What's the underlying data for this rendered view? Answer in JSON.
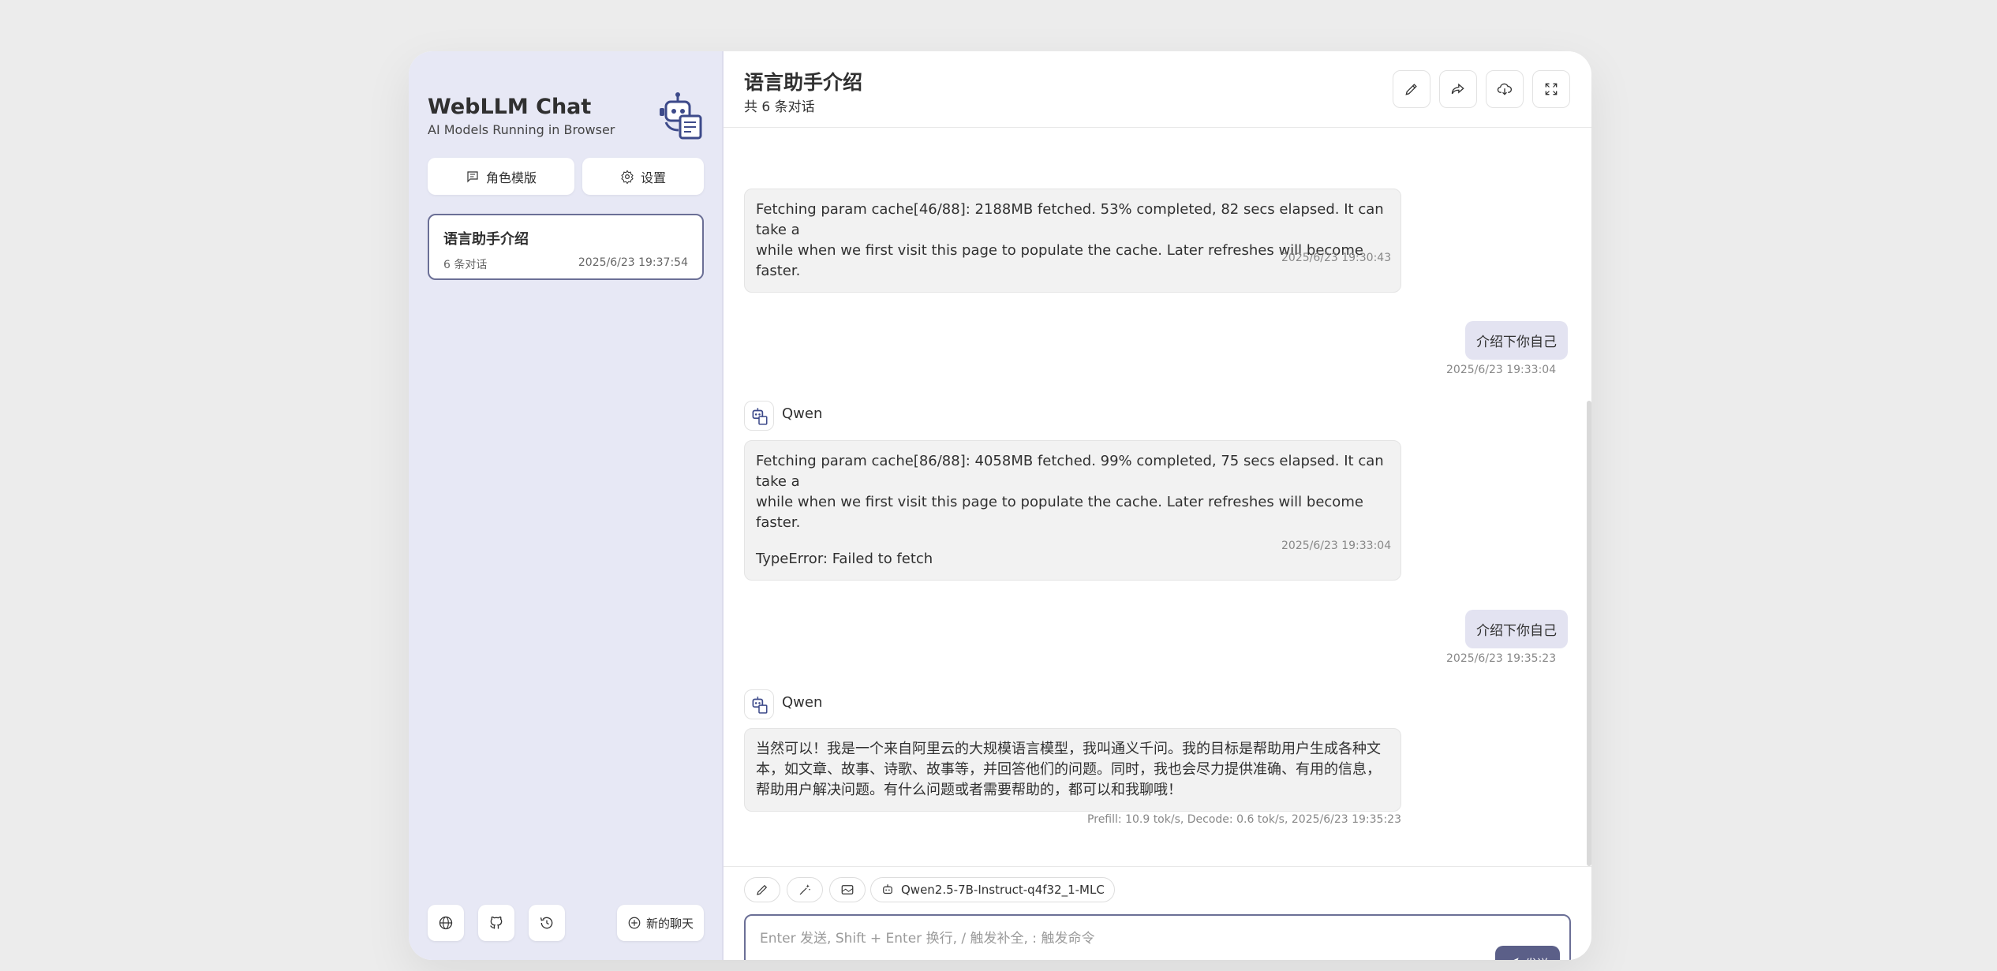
{
  "sidebar": {
    "title": "WebLLM Chat",
    "subtitle": "AI Models Running in Browser",
    "mask_button": "角色模版",
    "settings_button": "设置",
    "chats": [
      {
        "title": "语言助手介绍",
        "count": "6 条对话",
        "date": "2025/6/23 19:37:54"
      }
    ],
    "new_chat": "新的聊天"
  },
  "header": {
    "title": "语言助手介绍",
    "subtitle": "共 6 条对话"
  },
  "messages": [
    {
      "role": "bot",
      "lines": [
        "Fetching param cache[46/88]: 2188MB fetched. 53% completed, 82 secs elapsed. It can take a",
        "while when we first visit this page to populate the cache. Later refreshes will become faster."
      ],
      "time": "2025/6/23 19:30:43"
    },
    {
      "role": "user",
      "text": "介绍下你自己",
      "time": "2025/6/23 19:33:04"
    },
    {
      "role": "bot",
      "name": "Qwen",
      "lines": [
        "Fetching param cache[86/88]: 4058MB fetched. 99% completed, 75 secs elapsed. It can take a",
        "while when we first visit this page to populate the cache. Later refreshes will become faster."
      ],
      "extra": "TypeError: Failed to fetch",
      "time": "2025/6/23 19:33:04"
    },
    {
      "role": "user",
      "text": "介绍下你自己",
      "time": "2025/6/23 19:35:23"
    },
    {
      "role": "bot",
      "name": "Qwen",
      "lines": [
        "当然可以！我是一个来自阿里云的大规模语言模型，我叫通义千问。我的目标是帮助用户生成各种文",
        "本，如文章、故事、诗歌、故事等，并回答他们的问题。同时，我也会尽力提供准确、有用的信息，",
        "帮助用户解决问题。有什么问题或者需要帮助的，都可以和我聊哦！"
      ],
      "time": "Prefill: 10.9 tok/s,  Decode: 0.6 tok/s,  2025/6/23 19:35:23"
    }
  ],
  "input": {
    "model": "Qwen2.5-7B-Instruct-q4f32_1-MLC",
    "placeholder": "Enter 发送, Shift + Enter 换行, / 触发补全, : 触发命令",
    "send": "发送"
  },
  "colors": {
    "sidebar_bg": "#e7e8f5",
    "accent": "#5b5f88",
    "user_bubble": "#e3e3f1",
    "bot_bubble": "#f2f2f2"
  }
}
